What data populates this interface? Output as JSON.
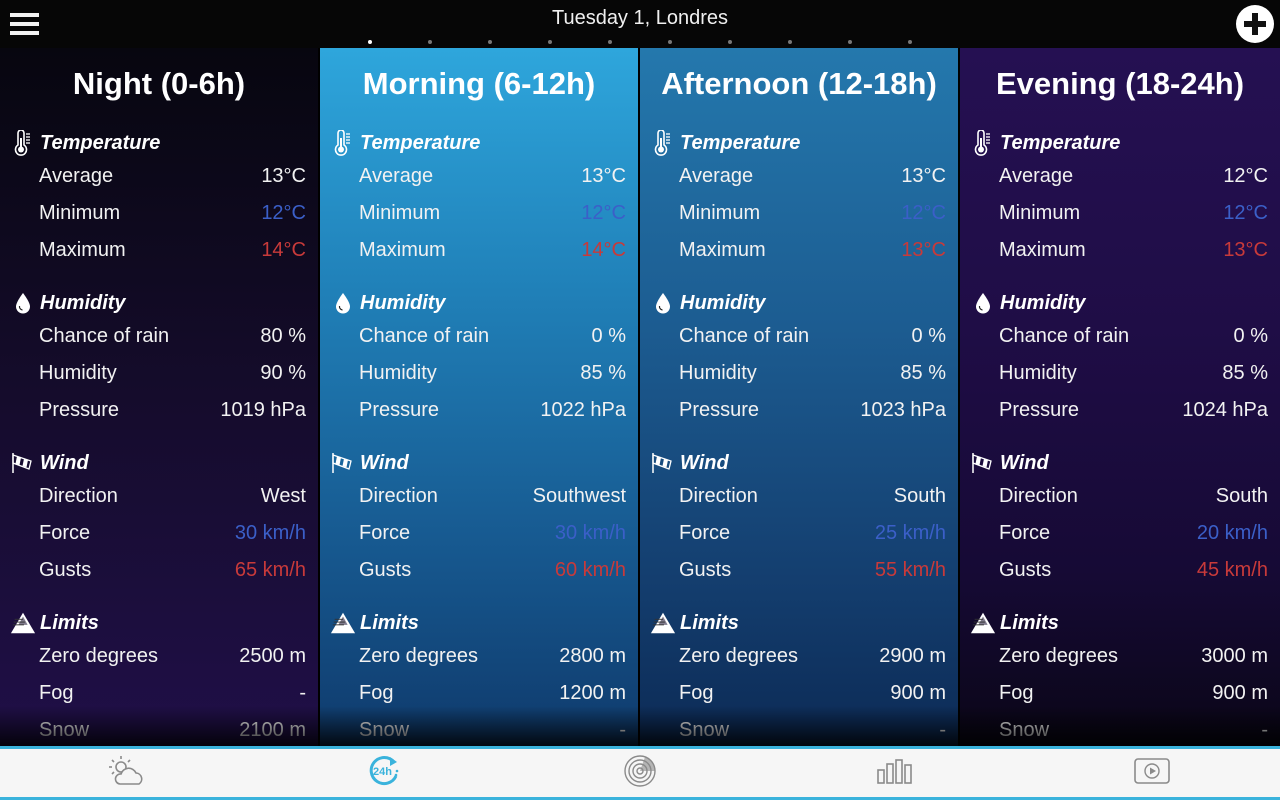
{
  "header": {
    "title": "Tuesday 1, Londres",
    "menu_icon": "hamburger-menu-icon",
    "add_icon": "plus-circle-icon",
    "page_indicator": {
      "count": 10,
      "active_index": 0
    }
  },
  "colors": {
    "accent": "#3ab3dc",
    "cold": "#3b5fc8",
    "hot": "#c83a3a",
    "night_bg": "#150c2c",
    "morning_bg": "#2ea6dc",
    "afternoon_bg": "#1c5c91",
    "evening_bg": "#1f0d46"
  },
  "columns": [
    {
      "title": "Night (0-6h)",
      "temperature": {
        "label": "Temperature",
        "icon": "thermometer-icon",
        "rows": [
          {
            "k": "Average",
            "v": "13°C"
          },
          {
            "k": "Minimum",
            "v": "12°C"
          },
          {
            "k": "Maximum",
            "v": "14°C"
          }
        ]
      },
      "humidity": {
        "label": "Humidity",
        "icon": "water-drop-icon",
        "rows": [
          {
            "k": "Chance of rain",
            "v": "80 %"
          },
          {
            "k": "Humidity",
            "v": "90 %"
          },
          {
            "k": "Pressure",
            "v": "1019 hPa"
          }
        ]
      },
      "wind": {
        "label": "Wind",
        "icon": "windsock-icon",
        "rows": [
          {
            "k": "Direction",
            "v": "West"
          },
          {
            "k": "Force",
            "v": "30 km/h"
          },
          {
            "k": "Gusts",
            "v": "65 km/h"
          }
        ]
      },
      "limits": {
        "label": "Limits",
        "icon": "mountain-limits-icon",
        "rows": [
          {
            "k": "Zero degrees",
            "v": "2500 m"
          },
          {
            "k": "Fog",
            "v": "-"
          },
          {
            "k": "Snow",
            "v": "2100 m"
          }
        ]
      }
    },
    {
      "title": "Morning (6-12h)",
      "temperature": {
        "label": "Temperature",
        "icon": "thermometer-icon",
        "rows": [
          {
            "k": "Average",
            "v": "13°C"
          },
          {
            "k": "Minimum",
            "v": "12°C"
          },
          {
            "k": "Maximum",
            "v": "14°C"
          }
        ]
      },
      "humidity": {
        "label": "Humidity",
        "icon": "water-drop-icon",
        "rows": [
          {
            "k": "Chance of rain",
            "v": "0 %"
          },
          {
            "k": "Humidity",
            "v": "85 %"
          },
          {
            "k": "Pressure",
            "v": "1022 hPa"
          }
        ]
      },
      "wind": {
        "label": "Wind",
        "icon": "windsock-icon",
        "rows": [
          {
            "k": "Direction",
            "v": "Southwest"
          },
          {
            "k": "Force",
            "v": "30 km/h"
          },
          {
            "k": "Gusts",
            "v": "60 km/h"
          }
        ]
      },
      "limits": {
        "label": "Limits",
        "icon": "mountain-limits-icon",
        "rows": [
          {
            "k": "Zero degrees",
            "v": "2800 m"
          },
          {
            "k": "Fog",
            "v": "1200 m"
          },
          {
            "k": "Snow",
            "v": "-"
          }
        ]
      }
    },
    {
      "title": "Afternoon (12-18h)",
      "temperature": {
        "label": "Temperature",
        "icon": "thermometer-icon",
        "rows": [
          {
            "k": "Average",
            "v": "13°C"
          },
          {
            "k": "Minimum",
            "v": "12°C"
          },
          {
            "k": "Maximum",
            "v": "13°C"
          }
        ]
      },
      "humidity": {
        "label": "Humidity",
        "icon": "water-drop-icon",
        "rows": [
          {
            "k": "Chance of rain",
            "v": "0 %"
          },
          {
            "k": "Humidity",
            "v": "85 %"
          },
          {
            "k": "Pressure",
            "v": "1023 hPa"
          }
        ]
      },
      "wind": {
        "label": "Wind",
        "icon": "windsock-icon",
        "rows": [
          {
            "k": "Direction",
            "v": "South"
          },
          {
            "k": "Force",
            "v": "25 km/h"
          },
          {
            "k": "Gusts",
            "v": "55 km/h"
          }
        ]
      },
      "limits": {
        "label": "Limits",
        "icon": "mountain-limits-icon",
        "rows": [
          {
            "k": "Zero degrees",
            "v": "2900 m"
          },
          {
            "k": "Fog",
            "v": "900 m"
          },
          {
            "k": "Snow",
            "v": "-"
          }
        ]
      }
    },
    {
      "title": "Evening (18-24h)",
      "temperature": {
        "label": "Temperature",
        "icon": "thermometer-icon",
        "rows": [
          {
            "k": "Average",
            "v": "12°C"
          },
          {
            "k": "Minimum",
            "v": "12°C"
          },
          {
            "k": "Maximum",
            "v": "13°C"
          }
        ]
      },
      "humidity": {
        "label": "Humidity",
        "icon": "water-drop-icon",
        "rows": [
          {
            "k": "Chance of rain",
            "v": "0 %"
          },
          {
            "k": "Humidity",
            "v": "85 %"
          },
          {
            "k": "Pressure",
            "v": "1024 hPa"
          }
        ]
      },
      "wind": {
        "label": "Wind",
        "icon": "windsock-icon",
        "rows": [
          {
            "k": "Direction",
            "v": "South"
          },
          {
            "k": "Force",
            "v": "20 km/h"
          },
          {
            "k": "Gusts",
            "v": "45 km/h"
          }
        ]
      },
      "limits": {
        "label": "Limits",
        "icon": "mountain-limits-icon",
        "rows": [
          {
            "k": "Zero degrees",
            "v": "3000 m"
          },
          {
            "k": "Fog",
            "v": "900 m"
          },
          {
            "k": "Snow",
            "v": "-"
          }
        ]
      }
    }
  ],
  "bottom_nav": [
    {
      "name": "forecast",
      "icon": "sun-cloud-icon",
      "active": false
    },
    {
      "name": "24h",
      "icon": "24h-clock-icon",
      "active": true
    },
    {
      "name": "radar",
      "icon": "radar-icon",
      "active": false
    },
    {
      "name": "charts",
      "icon": "bar-chart-icon",
      "active": false
    },
    {
      "name": "video",
      "icon": "video-play-icon",
      "active": false
    }
  ]
}
